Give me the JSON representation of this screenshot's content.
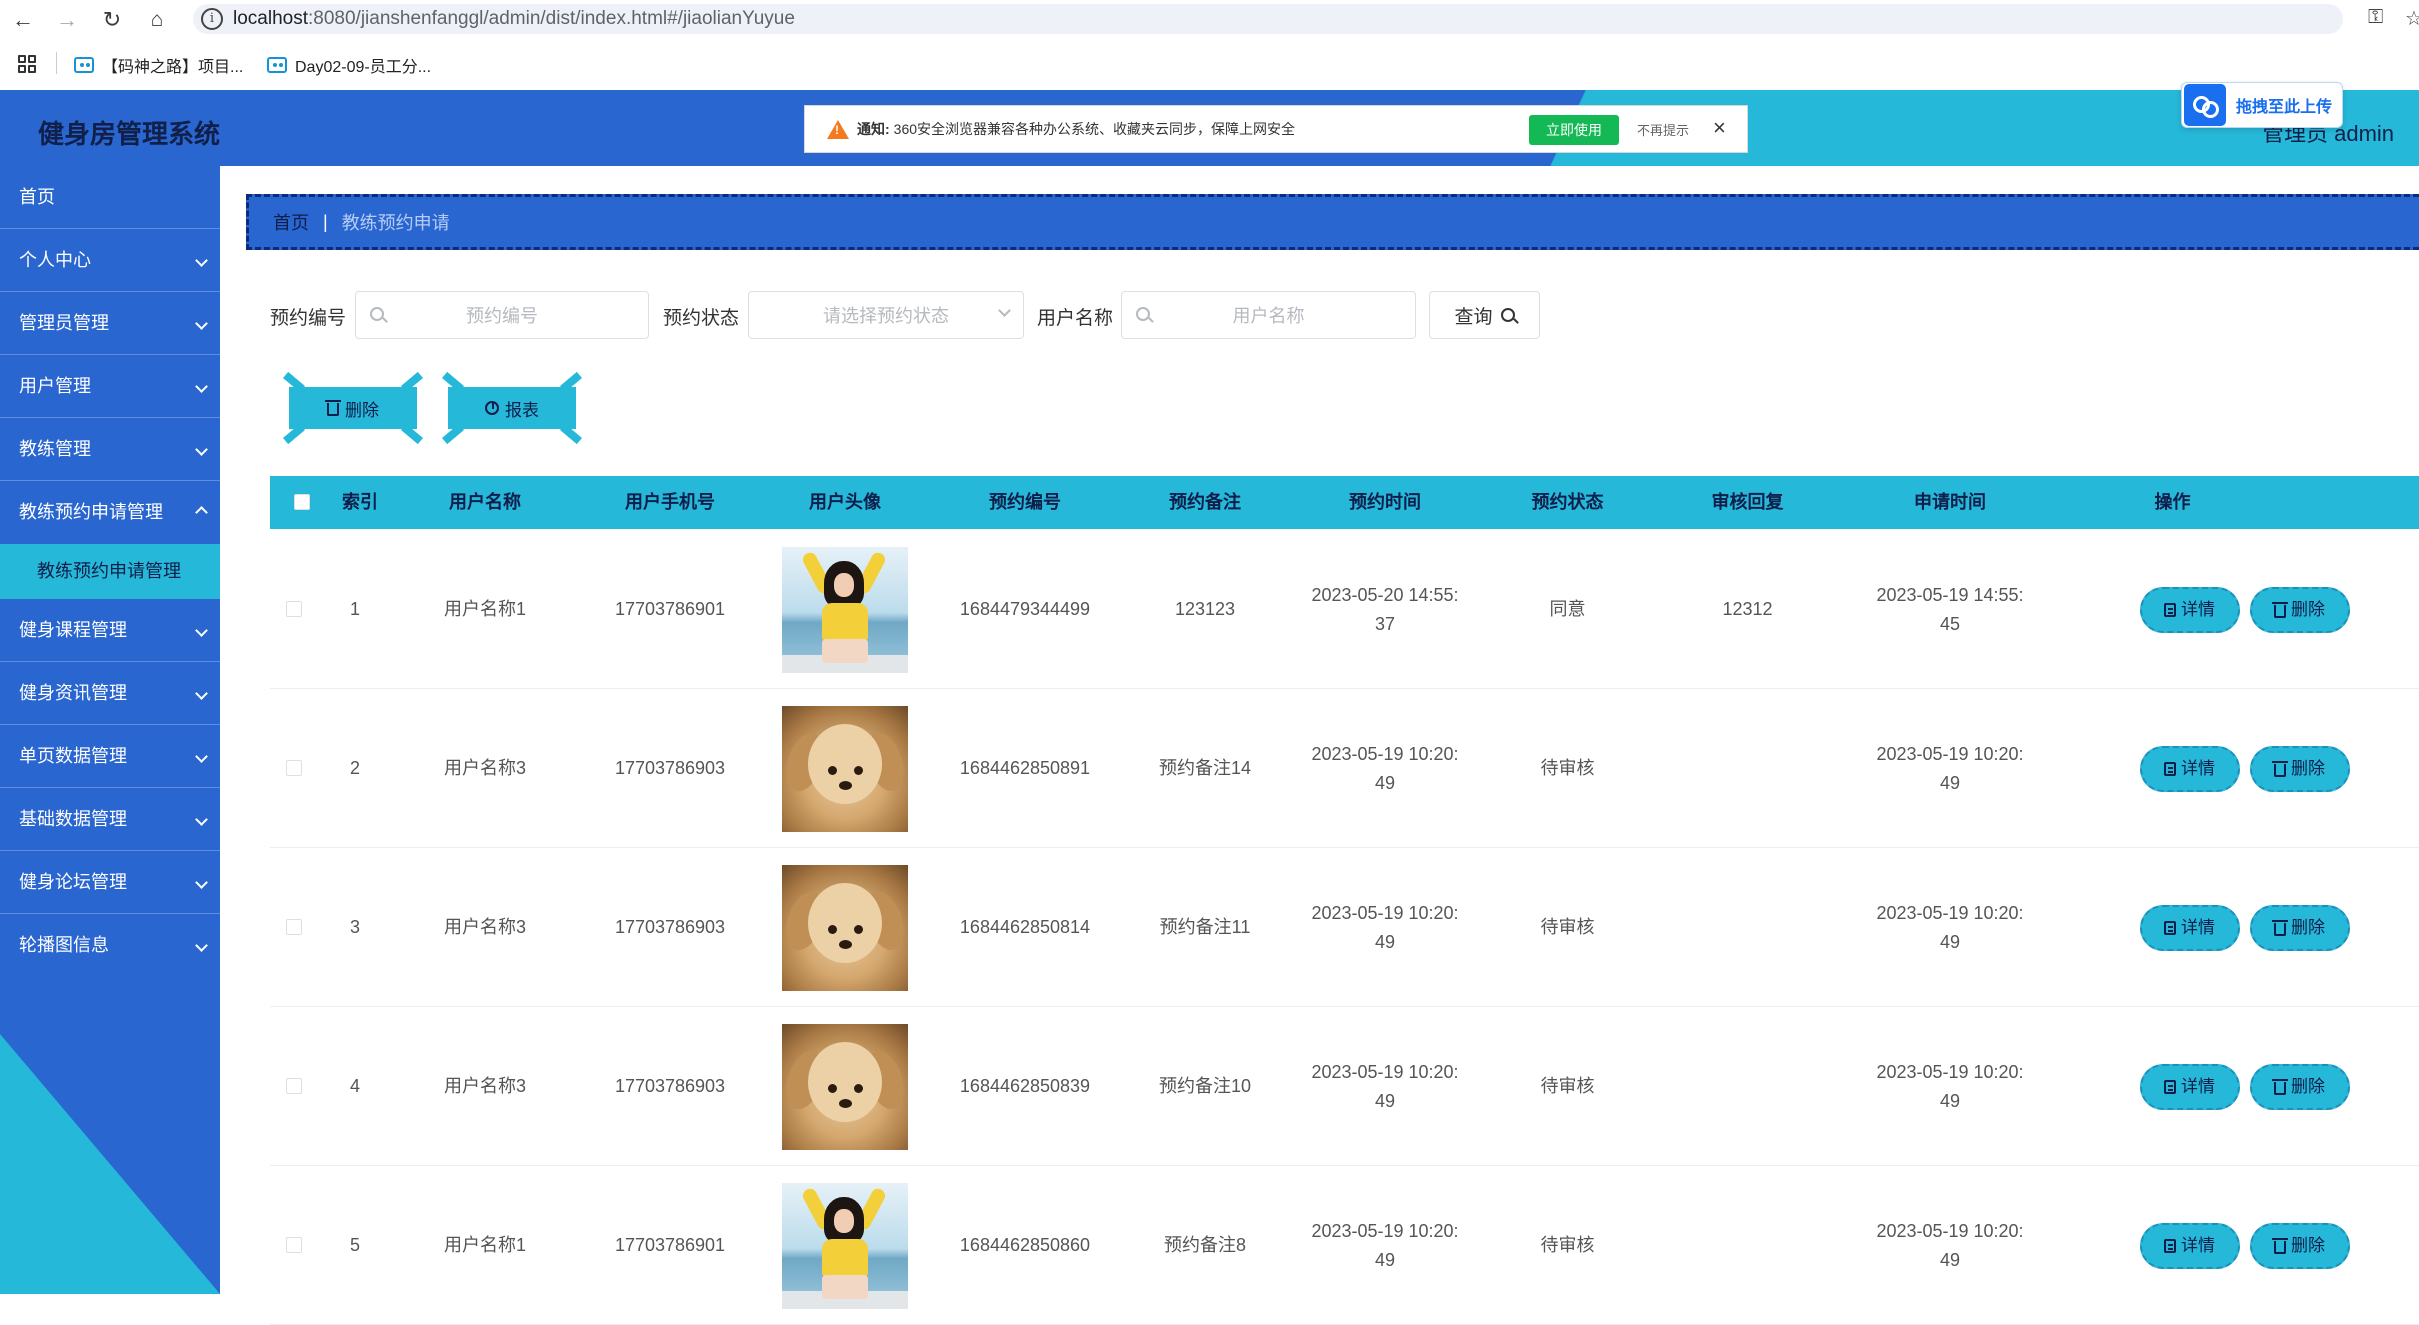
{
  "browser": {
    "url_host": "localhost",
    "url_rest": ":8080/jianshenfanggl/admin/dist/index.html#/jiaolianYuyue",
    "bookmarks": [
      "【码神之路】项目...",
      "Day02-09-员工分..."
    ]
  },
  "header": {
    "title": "健身房管理系统",
    "user": "管理员 admin"
  },
  "notice": {
    "prefix": "通知:",
    "text": "360安全浏览器兼容各种办公系统、收藏夹云同步，保障上网安全",
    "use_label": "立即使用",
    "noshow_label": "不再提示",
    "close": "×"
  },
  "upload_box": {
    "label": "拖拽至此上传"
  },
  "sidebar": {
    "items": [
      "首页",
      "个人中心",
      "管理员管理",
      "用户管理",
      "教练管理",
      "教练预约申请管理"
    ],
    "active_sub": "教练预约申请管理",
    "items_after": [
      "健身课程管理",
      "健身资讯管理",
      "单页数据管理",
      "基础数据管理",
      "健身论坛管理",
      "轮播图信息"
    ]
  },
  "breadcrumb": {
    "home": "首页",
    "sep": "|",
    "current": "教练预约申请"
  },
  "search": {
    "order_label": "预约编号",
    "order_placeholder": "预约编号",
    "status_label": "预约状态",
    "status_placeholder": "请选择预约状态",
    "user_label": "用户名称",
    "user_placeholder": "用户名称",
    "query_label": "查询"
  },
  "actions": {
    "delete_label": "删除",
    "report_label": "报表"
  },
  "table": {
    "headers": [
      "索引",
      "用户名称",
      "用户手机号",
      "用户头像",
      "预约编号",
      "预约备注",
      "预约时间",
      "预约状态",
      "审核回复",
      "申请时间",
      "操作"
    ],
    "detail_label": "详情",
    "delete_label": "删除",
    "rows": [
      {
        "index": "1",
        "user": "用户名称1",
        "phone": "17703786901",
        "avatar": "girl",
        "order": "1684479344499",
        "remark": "123123",
        "time1": "2023-05-20 14:55:",
        "time2": "37",
        "status": "同意",
        "reply": "12312",
        "apply1": "2023-05-19 14:55:",
        "apply2": "45"
      },
      {
        "index": "2",
        "user": "用户名称3",
        "phone": "17703786903",
        "avatar": "dog",
        "order": "1684462850891",
        "remark": "预约备注14",
        "time1": "2023-05-19 10:20:",
        "time2": "49",
        "status": "待审核",
        "reply": "",
        "apply1": "2023-05-19 10:20:",
        "apply2": "49"
      },
      {
        "index": "3",
        "user": "用户名称3",
        "phone": "17703786903",
        "avatar": "dog",
        "order": "1684462850814",
        "remark": "预约备注11",
        "time1": "2023-05-19 10:20:",
        "time2": "49",
        "status": "待审核",
        "reply": "",
        "apply1": "2023-05-19 10:20:",
        "apply2": "49"
      },
      {
        "index": "4",
        "user": "用户名称3",
        "phone": "17703786903",
        "avatar": "dog",
        "order": "1684462850839",
        "remark": "预约备注10",
        "time1": "2023-05-19 10:20:",
        "time2": "49",
        "status": "待审核",
        "reply": "",
        "apply1": "2023-05-19 10:20:",
        "apply2": "49"
      },
      {
        "index": "5",
        "user": "用户名称1",
        "phone": "17703786901",
        "avatar": "girl",
        "order": "1684462850860",
        "remark": "预约备注8",
        "time1": "2023-05-19 10:20:",
        "time2": "49",
        "status": "待审核",
        "reply": "",
        "apply1": "2023-05-19 10:20:",
        "apply2": "49"
      }
    ]
  },
  "colors": {
    "primary": "#2a66d0",
    "accent": "#26b8d9",
    "dark_text": "#0f1e4a"
  }
}
